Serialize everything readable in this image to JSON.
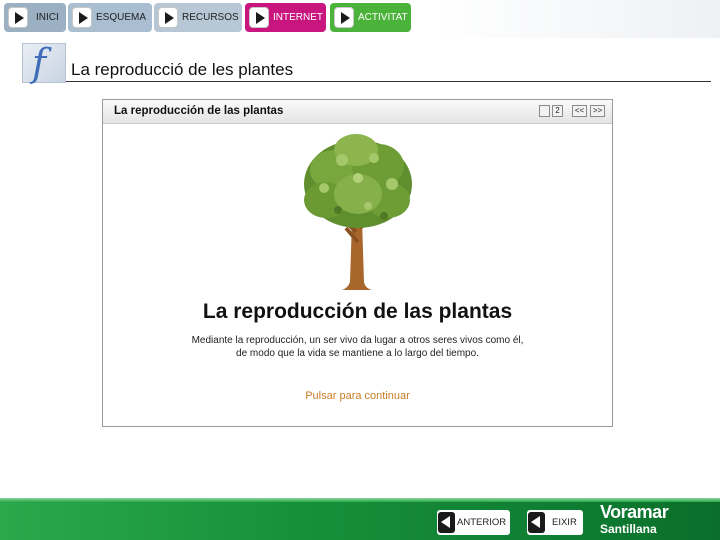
{
  "nav": {
    "items": [
      {
        "label": "INICI",
        "color": "#9bb0c3"
      },
      {
        "label": "ESQUEMA",
        "color": "#a9bfd1"
      },
      {
        "label": "RECURSOS",
        "color": "#b7c7d6"
      },
      {
        "label": "INTERNET",
        "color": "#c9157e"
      },
      {
        "label": "ACTIVITAT",
        "color": "#4bb33a"
      }
    ]
  },
  "header": {
    "title": "La reproducció de les plantes",
    "icon": "flash-icon"
  },
  "content": {
    "window_title": "La reproducción de las plantas",
    "controls": [
      "",
      "2",
      "<<",
      ">>"
    ],
    "heading": "La reproducción de las plantas",
    "text_line_1": "Mediante la reproducción, un ser vivo da lugar a otros seres vivos como él,",
    "text_line_2": "de modo que la vida se mantiene a lo largo del tiempo.",
    "continue_label": "Pulsar para continuar"
  },
  "footer": {
    "prev_label": "ANTERIOR",
    "exit_label": "EIXIR",
    "brand_line_1": "Voramar",
    "brand_line_2": "Santillana"
  },
  "colors": {
    "accent_green": "#18913b",
    "internet_pink": "#c9157e",
    "link_orange": "#c77c26"
  }
}
